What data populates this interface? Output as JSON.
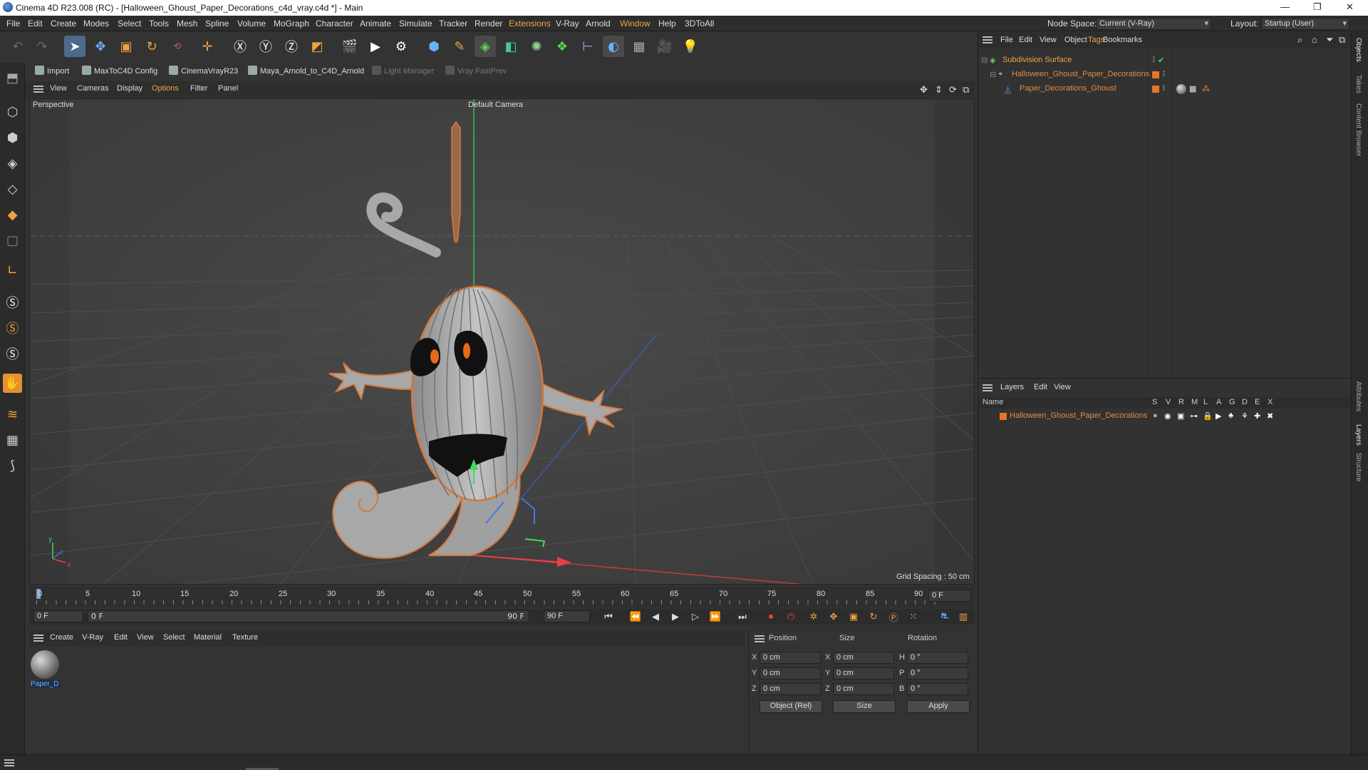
{
  "window": {
    "title": "Cinema 4D R23.008 (RC) - [Halloween_Ghoust_Paper_Decorations_c4d_vray.c4d *] - Main",
    "controls": [
      "—",
      "❐",
      "✕"
    ]
  },
  "menubar": {
    "items": [
      "File",
      "Edit",
      "Create",
      "Modes",
      "Select",
      "Tools",
      "Mesh",
      "Spline",
      "Volume",
      "MoGraph",
      "Character",
      "Animate",
      "Simulate",
      "Tracker",
      "Render",
      "Extensions",
      "V-Ray",
      "Arnold",
      "Window",
      "Help",
      "3DToAll"
    ],
    "node_space_label": "Node Space:",
    "node_space_value": "Current (V-Ray)",
    "layout_label": "Layout:",
    "layout_value": "Startup (User)"
  },
  "scriptbar": {
    "items": [
      "Import",
      "MaxToC4D Config",
      "CinemaVrayR23",
      "Maya_Arnold_to_C4D_Arnold",
      "Light Manager",
      "Vray FastPrev"
    ]
  },
  "viewport_menu": {
    "items": [
      "View",
      "Cameras",
      "Display",
      "Options",
      "Filter",
      "Panel"
    ]
  },
  "viewport": {
    "view_name": "Perspective",
    "camera": "Default Camera",
    "grid_spacing": "Grid Spacing : 50 cm",
    "axis_y": "y",
    "axis_x": "x",
    "axis_z": "z"
  },
  "timeline": {
    "ticks": [
      "0",
      "5",
      "10",
      "15",
      "20",
      "25",
      "30",
      "35",
      "40",
      "45",
      "50",
      "55",
      "60",
      "65",
      "70",
      "75",
      "80",
      "85",
      "90"
    ],
    "current_frame": "0 F"
  },
  "transport": {
    "start": "0 F",
    "range_start": "0 F",
    "range_end": "90 F",
    "end": "90 F"
  },
  "material_menu": {
    "items": [
      "Create",
      "V-Ray",
      "Edit",
      "View",
      "Select",
      "Material",
      "Texture"
    ]
  },
  "material": {
    "name": "Paper_D"
  },
  "coords": {
    "headers": [
      "Position",
      "Size",
      "Rotation"
    ],
    "rows": [
      {
        "axis": "X",
        "pos": "0 cm",
        "saxis": "X",
        "size": "0 cm",
        "raxis": "H",
        "rot": "0 °"
      },
      {
        "axis": "Y",
        "pos": "0 cm",
        "saxis": "Y",
        "size": "0 cm",
        "raxis": "P",
        "rot": "0 °"
      },
      {
        "axis": "Z",
        "pos": "0 cm",
        "saxis": "Z",
        "size": "0 cm",
        "raxis": "B",
        "rot": "0 °"
      }
    ],
    "mode": "Object (Rel)",
    "size_mode": "Size",
    "apply": "Apply"
  },
  "object_manager": {
    "menu": [
      "File",
      "Edit",
      "View",
      "Object",
      "Tags",
      "Bookmarks"
    ],
    "objects": [
      "Subdivision Surface",
      "Halloween_Ghoust_Paper_Decorations",
      "Paper_Decorations_Ghoust"
    ]
  },
  "layer_manager": {
    "menu": [
      "Layers",
      "Edit",
      "View"
    ],
    "name_header": "Name",
    "flags": [
      "S",
      "V",
      "R",
      "M",
      "L",
      "A",
      "G",
      "D",
      "E",
      "X"
    ],
    "layers": [
      "Halloween_Ghoust_Paper_Decorations"
    ]
  },
  "right_tabs": [
    "Objects",
    "Takes",
    "Content Browser",
    "Attributes",
    "Layers",
    "Structure"
  ],
  "colors": {
    "accent": "#e8a840",
    "object_orange": "#e88a40",
    "green": "#58d858"
  }
}
